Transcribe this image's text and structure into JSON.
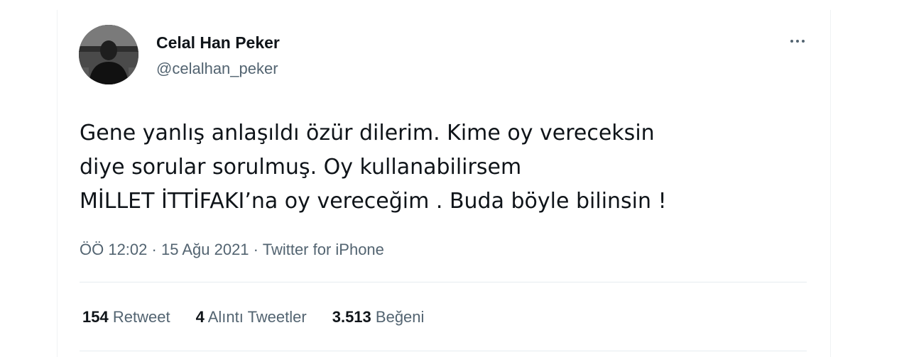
{
  "author": {
    "name": "Celal Han Peker",
    "handle": "@celalhan_peker"
  },
  "more_menu_icon": "more-horizontal-icon",
  "tweet": {
    "lines": [
      "Gene yanlış anlaşıldı özür dilerim. Kime oy vereceksin",
      "diye sorular sorulmuş. Oy kullanabilirsem",
      "MİLLET İTTİFAKI’na oy vereceğim . Buda böyle bilinsin !"
    ]
  },
  "meta": {
    "time": "ÖÖ 12:02",
    "separator": "·",
    "date": "15 Ağu 2021",
    "source": "Twitter for iPhone"
  },
  "stats": [
    {
      "count": "154",
      "label": "Retweet"
    },
    {
      "count": "4",
      "label": "Alıntı Tweetler"
    },
    {
      "count": "3.513",
      "label": "Beğeni"
    }
  ],
  "colors": {
    "text_primary": "#0f1419",
    "text_secondary": "#536471",
    "divider": "#e6ecf0"
  }
}
